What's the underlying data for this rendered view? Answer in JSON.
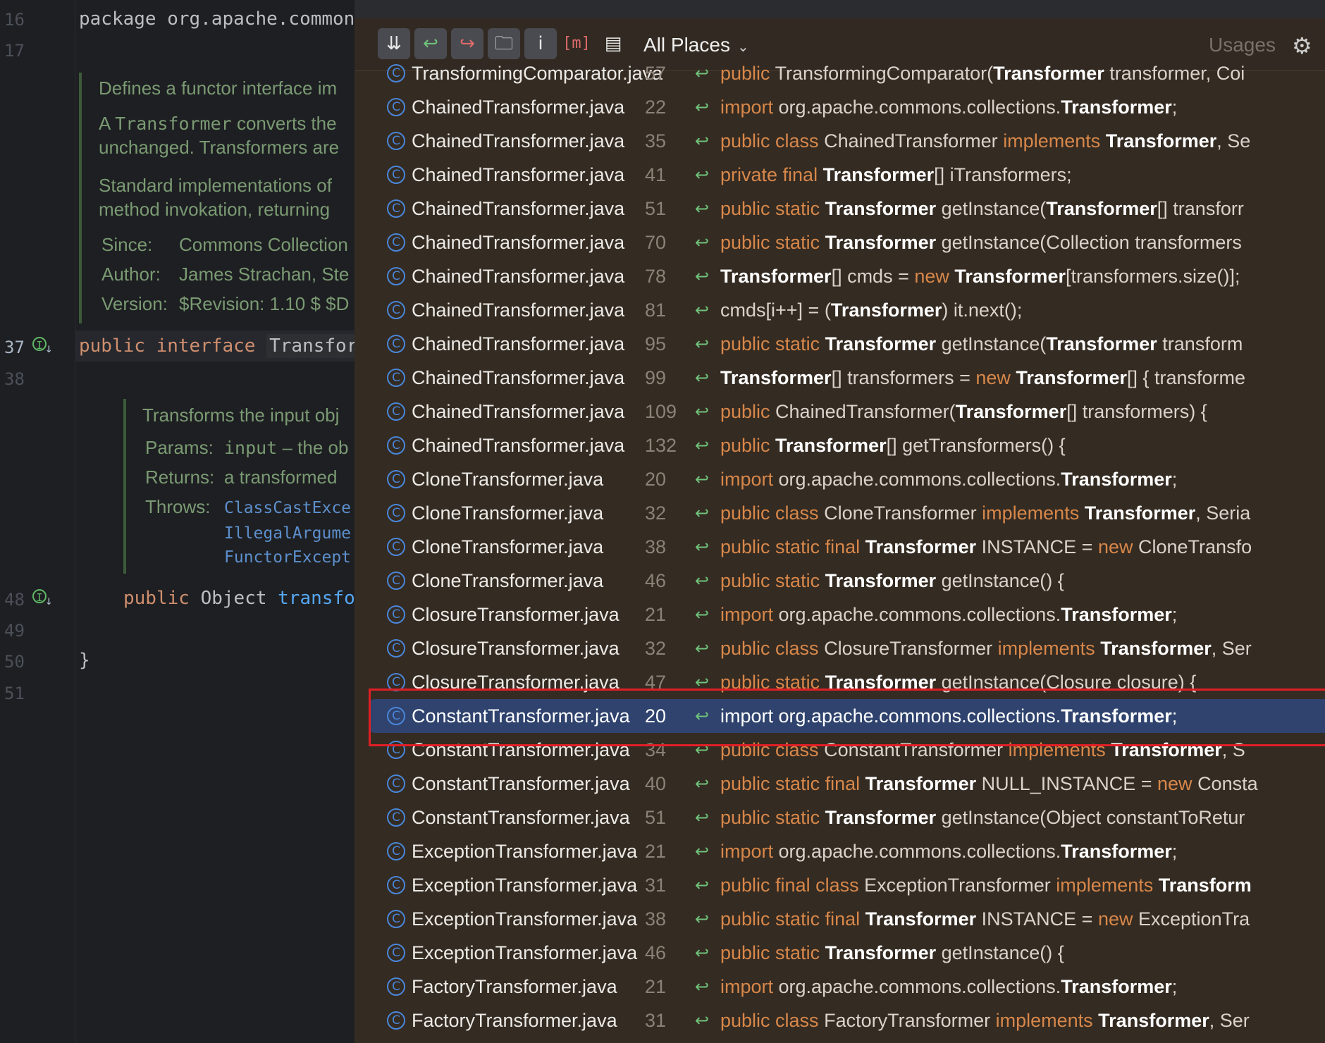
{
  "editor": {
    "line_numbers": [
      "16",
      "17",
      "37",
      "38",
      "48",
      "49",
      "50",
      "51"
    ],
    "package_line": "package org.apache.common",
    "doc": {
      "p1": "Defines a functor interface im",
      "p2a": "A ",
      "p2b": "Transformer",
      "p2c": " converts the",
      "p2d": "unchanged. Transformers are",
      "p3a": "Standard implementations of",
      "p3b": "method invokation, returning",
      "since_label": "Since:",
      "since_value": "Commons Collection",
      "author_label": "Author:",
      "author_value": "James Strachan, Ste",
      "version_label": "Version:",
      "version_value": "$Revision: 1.10 $ $D"
    },
    "decl": {
      "kw1": "public",
      "kw2": "interface",
      "name": "Transfor"
    },
    "method_doc": {
      "p1": "Transforms the input obj",
      "params_label": "Params:",
      "params_value_mono": "input",
      "params_value_rest": " – the ob",
      "returns_label": "Returns:",
      "returns_value": "a transformed",
      "throws_label": "Throws:",
      "throws": [
        "ClassCastExce",
        "IllegalArgume",
        "FunctorExcept"
      ]
    },
    "method": {
      "kw": "public",
      "type": "Object",
      "name": "transfo"
    },
    "closing_brace": "}"
  },
  "popup": {
    "scope": "All Places",
    "usages_label": "Usages",
    "toolbar_icons": [
      "merge-icon",
      "previous-occurrence-icon",
      "next-occurrence-icon",
      "open-in-find-tool-icon",
      "info-icon",
      "method-icon",
      "preview-icon"
    ],
    "rows": [
      {
        "file": "TransformingComparator.java",
        "line": "57",
        "parts": [
          [
            "k",
            "public "
          ],
          [
            "t",
            "TransformingComparator("
          ],
          [
            "b",
            "Transformer"
          ],
          [
            "t",
            " transformer, Coi"
          ]
        ]
      },
      {
        "file": "ChainedTransformer.java",
        "line": "22",
        "parts": [
          [
            "k",
            "import "
          ],
          [
            "t",
            "org.apache.commons.collections."
          ],
          [
            "b",
            "Transformer"
          ],
          [
            "t",
            ";"
          ]
        ]
      },
      {
        "file": "ChainedTransformer.java",
        "line": "35",
        "parts": [
          [
            "k",
            "public class "
          ],
          [
            "t",
            "ChainedTransformer "
          ],
          [
            "k",
            "implements "
          ],
          [
            "b",
            "Transformer"
          ],
          [
            "t",
            ", Se"
          ]
        ]
      },
      {
        "file": "ChainedTransformer.java",
        "line": "41",
        "parts": [
          [
            "k",
            "private final "
          ],
          [
            "b",
            "Transformer"
          ],
          [
            "t",
            "[] iTransformers;"
          ]
        ]
      },
      {
        "file": "ChainedTransformer.java",
        "line": "51",
        "parts": [
          [
            "k",
            "public static "
          ],
          [
            "b",
            "Transformer"
          ],
          [
            "t",
            " getInstance("
          ],
          [
            "b",
            "Transformer"
          ],
          [
            "t",
            "[] transforr"
          ]
        ]
      },
      {
        "file": "ChainedTransformer.java",
        "line": "70",
        "parts": [
          [
            "k",
            "public static "
          ],
          [
            "b",
            "Transformer"
          ],
          [
            "t",
            " getInstance(Collection transformers"
          ]
        ]
      },
      {
        "file": "ChainedTransformer.java",
        "line": "78",
        "parts": [
          [
            "b",
            "Transformer"
          ],
          [
            "t",
            "[] cmds = "
          ],
          [
            "k",
            "new "
          ],
          [
            "b",
            "Transformer"
          ],
          [
            "t",
            "[transformers.size()];"
          ]
        ]
      },
      {
        "file": "ChainedTransformer.java",
        "line": "81",
        "parts": [
          [
            "t",
            "cmds[i++] = ("
          ],
          [
            "b",
            "Transformer"
          ],
          [
            "t",
            ") it.next();"
          ]
        ]
      },
      {
        "file": "ChainedTransformer.java",
        "line": "95",
        "parts": [
          [
            "k",
            "public static "
          ],
          [
            "b",
            "Transformer"
          ],
          [
            "t",
            " getInstance("
          ],
          [
            "b",
            "Transformer"
          ],
          [
            "t",
            " transform"
          ]
        ]
      },
      {
        "file": "ChainedTransformer.java",
        "line": "99",
        "parts": [
          [
            "b",
            "Transformer"
          ],
          [
            "t",
            "[] transformers = "
          ],
          [
            "k",
            "new "
          ],
          [
            "b",
            "Transformer"
          ],
          [
            "t",
            "[] { transforme"
          ]
        ]
      },
      {
        "file": "ChainedTransformer.java",
        "line": "109",
        "parts": [
          [
            "k",
            "public "
          ],
          [
            "t",
            "ChainedTransformer("
          ],
          [
            "b",
            "Transformer"
          ],
          [
            "t",
            "[] transformers) {"
          ]
        ]
      },
      {
        "file": "ChainedTransformer.java",
        "line": "132",
        "parts": [
          [
            "k",
            "public "
          ],
          [
            "b",
            "Transformer"
          ],
          [
            "t",
            "[] getTransformers() {"
          ]
        ]
      },
      {
        "file": "CloneTransformer.java",
        "line": "20",
        "parts": [
          [
            "k",
            "import "
          ],
          [
            "t",
            "org.apache.commons.collections."
          ],
          [
            "b",
            "Transformer"
          ],
          [
            "t",
            ";"
          ]
        ]
      },
      {
        "file": "CloneTransformer.java",
        "line": "32",
        "parts": [
          [
            "k",
            "public class "
          ],
          [
            "t",
            "CloneTransformer "
          ],
          [
            "k",
            "implements "
          ],
          [
            "b",
            "Transformer"
          ],
          [
            "t",
            ", Seria"
          ]
        ]
      },
      {
        "file": "CloneTransformer.java",
        "line": "38",
        "parts": [
          [
            "k",
            "public static final "
          ],
          [
            "b",
            "Transformer"
          ],
          [
            "t",
            " INSTANCE = "
          ],
          [
            "k",
            "new "
          ],
          [
            "t",
            "CloneTransfo"
          ]
        ]
      },
      {
        "file": "CloneTransformer.java",
        "line": "46",
        "parts": [
          [
            "k",
            "public static "
          ],
          [
            "b",
            "Transformer"
          ],
          [
            "t",
            " getInstance() {"
          ]
        ]
      },
      {
        "file": "ClosureTransformer.java",
        "line": "21",
        "parts": [
          [
            "k",
            "import "
          ],
          [
            "t",
            "org.apache.commons.collections."
          ],
          [
            "b",
            "Transformer"
          ],
          [
            "t",
            ";"
          ]
        ]
      },
      {
        "file": "ClosureTransformer.java",
        "line": "32",
        "parts": [
          [
            "k",
            "public class "
          ],
          [
            "t",
            "ClosureTransformer "
          ],
          [
            "k",
            "implements "
          ],
          [
            "b",
            "Transformer"
          ],
          [
            "t",
            ", Ser"
          ]
        ]
      },
      {
        "file": "ClosureTransformer.java",
        "line": "47",
        "parts": [
          [
            "k",
            "public static "
          ],
          [
            "b",
            "Transformer"
          ],
          [
            "t",
            " getInstance(Closure closure) {"
          ]
        ]
      },
      {
        "file": "ConstantTransformer.java",
        "line": "20",
        "selected": true,
        "parts": [
          [
            "t",
            "import org.apache.commons.collections."
          ],
          [
            "b",
            "Transformer"
          ],
          [
            "t",
            ";"
          ]
        ]
      },
      {
        "file": "ConstantTransformer.java",
        "line": "34",
        "parts": [
          [
            "k",
            "public class "
          ],
          [
            "t",
            "ConstantTransformer "
          ],
          [
            "k",
            "implements "
          ],
          [
            "b",
            "Transformer"
          ],
          [
            "t",
            ", S"
          ]
        ]
      },
      {
        "file": "ConstantTransformer.java",
        "line": "40",
        "parts": [
          [
            "k",
            "public static final "
          ],
          [
            "b",
            "Transformer"
          ],
          [
            "t",
            " NULL_INSTANCE = "
          ],
          [
            "k",
            "new "
          ],
          [
            "t",
            "Consta"
          ]
        ]
      },
      {
        "file": "ConstantTransformer.java",
        "line": "51",
        "parts": [
          [
            "k",
            "public static "
          ],
          [
            "b",
            "Transformer"
          ],
          [
            "t",
            " getInstance(Object constantToRetur"
          ]
        ]
      },
      {
        "file": "ExceptionTransformer.java",
        "line": "21",
        "parts": [
          [
            "k",
            "import "
          ],
          [
            "t",
            "org.apache.commons.collections."
          ],
          [
            "b",
            "Transformer"
          ],
          [
            "t",
            ";"
          ]
        ]
      },
      {
        "file": "ExceptionTransformer.java",
        "line": "31",
        "parts": [
          [
            "k",
            "public final class "
          ],
          [
            "t",
            "ExceptionTransformer "
          ],
          [
            "k",
            "implements "
          ],
          [
            "b",
            "Transform"
          ]
        ]
      },
      {
        "file": "ExceptionTransformer.java",
        "line": "38",
        "parts": [
          [
            "k",
            "public static final "
          ],
          [
            "b",
            "Transformer"
          ],
          [
            "t",
            " INSTANCE = "
          ],
          [
            "k",
            "new "
          ],
          [
            "t",
            "ExceptionTra"
          ]
        ]
      },
      {
        "file": "ExceptionTransformer.java",
        "line": "46",
        "parts": [
          [
            "k",
            "public static "
          ],
          [
            "b",
            "Transformer"
          ],
          [
            "t",
            " getInstance() {"
          ]
        ]
      },
      {
        "file": "FactoryTransformer.java",
        "line": "21",
        "parts": [
          [
            "k",
            "import "
          ],
          [
            "t",
            "org.apache.commons.collections."
          ],
          [
            "b",
            "Transformer"
          ],
          [
            "t",
            ";"
          ]
        ]
      },
      {
        "file": "FactoryTransformer.java",
        "line": "31",
        "parts": [
          [
            "k",
            "public class "
          ],
          [
            "t",
            "FactoryTransformer "
          ],
          [
            "k",
            "implements "
          ],
          [
            "b",
            "Transformer"
          ],
          [
            "t",
            ", Ser"
          ]
        ]
      }
    ]
  }
}
